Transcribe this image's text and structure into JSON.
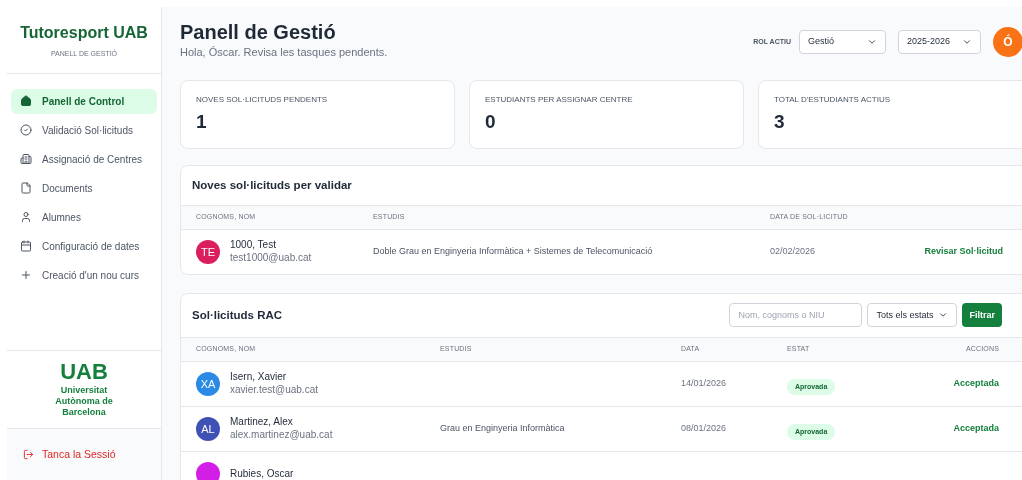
{
  "sidebar": {
    "title": "Tutoresport UAB",
    "subtitle": "PANELL DE GESTIÓ",
    "items": [
      {
        "label": "Panell de Control",
        "selected": true
      },
      {
        "label": "Validació Sol·licituds",
        "selected": false
      },
      {
        "label": "Assignació de Centres",
        "selected": false
      },
      {
        "label": "Documents",
        "selected": false
      },
      {
        "label": "Alumnes",
        "selected": false
      },
      {
        "label": "Configuració de dates",
        "selected": false
      },
      {
        "label": "Creació d'un nou curs",
        "selected": false
      }
    ],
    "logo": {
      "mark": "UAB",
      "name": "Universitat Autònoma de Barcelona"
    },
    "logout": "Tanca la Sessió"
  },
  "header": {
    "title": "Panell de Gestió",
    "subtitle": "Hola, Óscar. Revisa les tasques pendents.",
    "role_label": "ROL ACTIU",
    "role": "Gestió",
    "year": "2025-2026",
    "avatar": "Ó"
  },
  "stats": [
    {
      "label": "NOVES SOL·LICITUDS PENDENTS",
      "value": "1"
    },
    {
      "label": "ESTUDIANTS PER ASSIGNAR CENTRE",
      "value": "0"
    },
    {
      "label": "TOTAL D'ESTUDIANTS ACTIUS",
      "value": "3"
    }
  ],
  "pending": {
    "title": "Noves sol·licituds per validar",
    "columns": [
      "COGNOMS, NOM",
      "ESTUDIS",
      "DATA DE SOL·LICITUD"
    ],
    "rows": [
      {
        "initials": "TE",
        "color": "#db1e5f",
        "name": "1000, Test",
        "email": "test1000@uab.cat",
        "studies": "Doble Grau en Enginyeria Informàtica + Sistemes de Telecomunicació",
        "date": "02/02/2026",
        "action": "Revisar Sol·licitud"
      }
    ]
  },
  "rac": {
    "title": "Sol·licituds RAC",
    "search_placeholder": "Nom, cognoms o NIU",
    "filter": "Tots els estats",
    "button": "Filtrar",
    "columns": [
      "COGNOMS, NOM",
      "ESTUDIS",
      "DATA",
      "ESTAT",
      "ACCIONS"
    ],
    "rows": [
      {
        "initials": "XA",
        "color": "#2a8ae6",
        "name": "Isern, Xavier",
        "email": "xavier.test@uab.cat",
        "studies": "",
        "date": "14/01/2026",
        "status": "Aprovada",
        "action": "Acceptada"
      },
      {
        "initials": "AL",
        "color": "#3f51b5",
        "name": "Martinez, Alex",
        "email": "alex.martinez@uab.cat",
        "studies": "Grau en Enginyeria Informàtica",
        "date": "08/01/2026",
        "status": "Aprovada",
        "action": "Acceptada"
      },
      {
        "color": "#d21ee6",
        "name": "Rubies, Oscar"
      }
    ]
  }
}
